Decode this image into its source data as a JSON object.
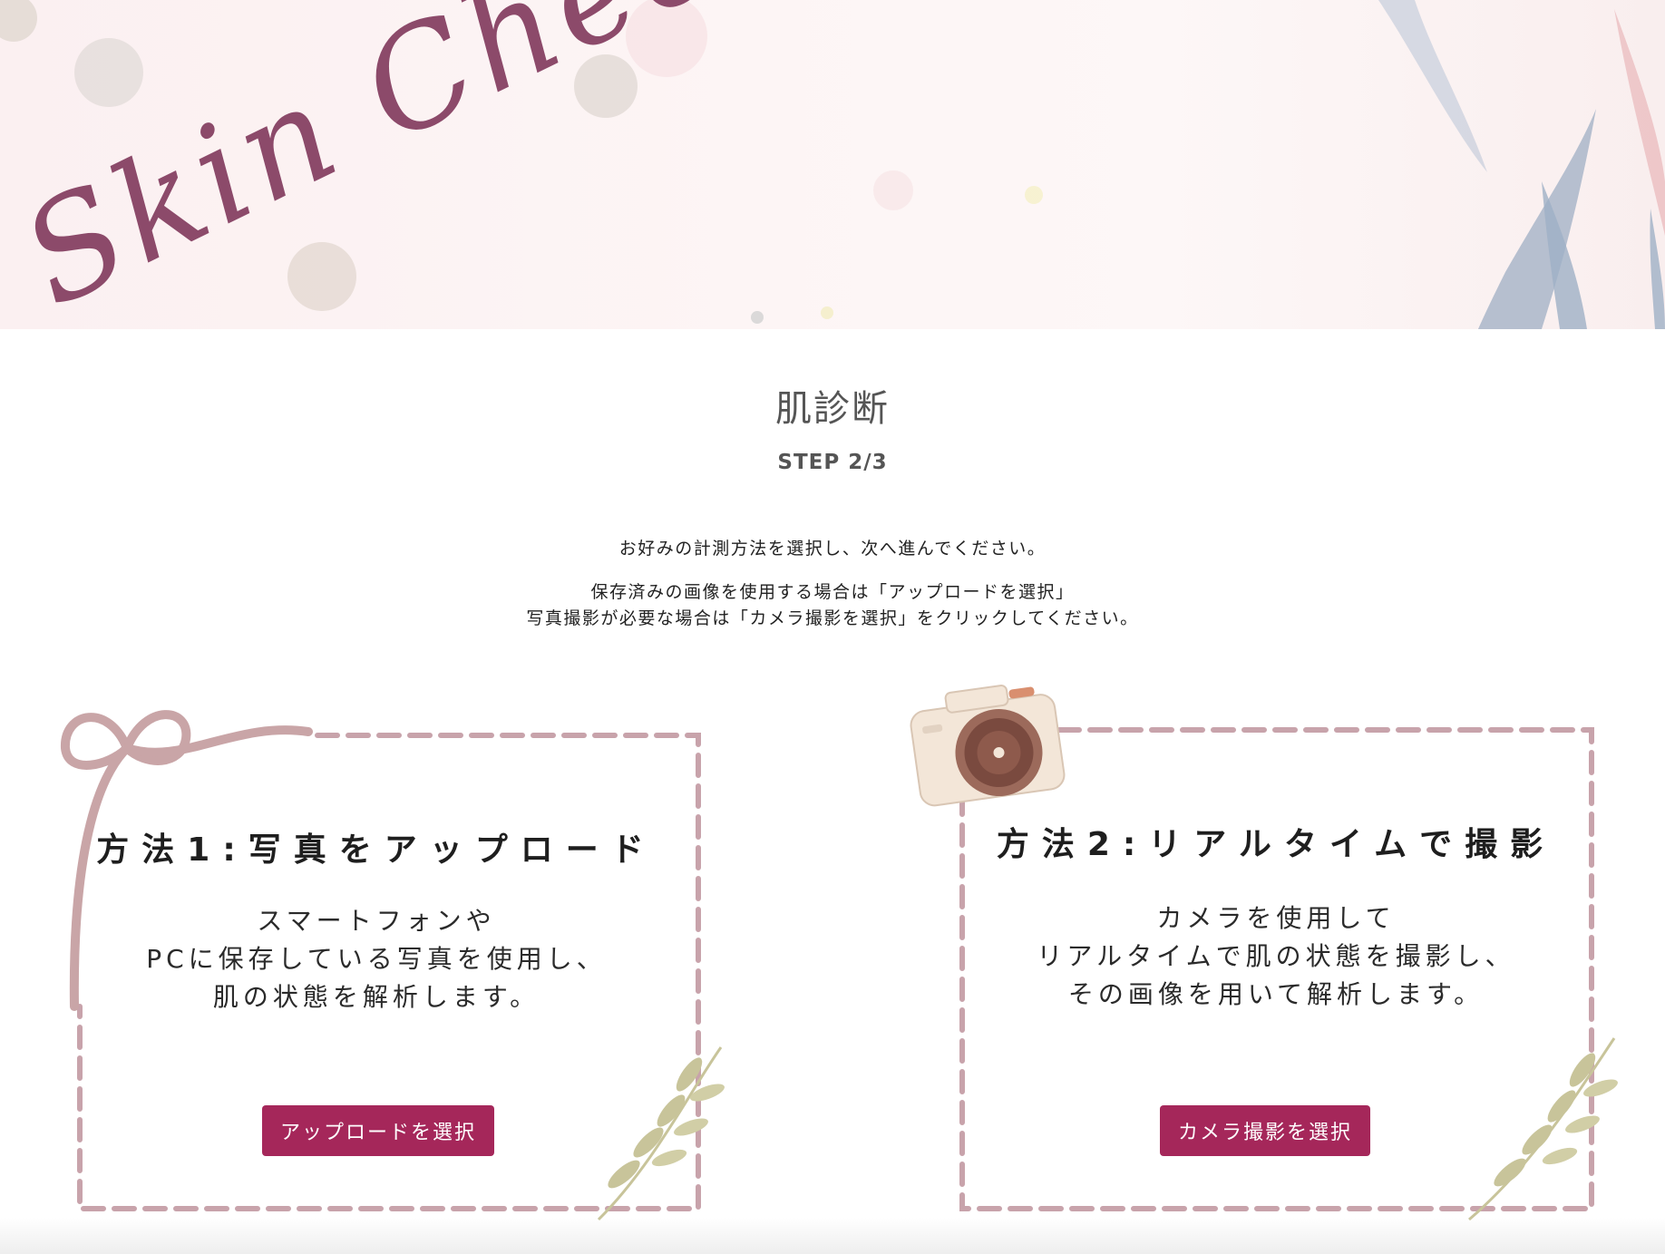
{
  "hero": {
    "script_title": "Skin Check"
  },
  "header": {
    "title": "肌診断",
    "step": "STEP 2/3"
  },
  "intro": {
    "line1": "お好みの計測方法を選択し、次へ進んでください。",
    "line2": "保存済みの画像を使用する場合は「アップロードを選択」",
    "line3": "写真撮影が必要な場合は「カメラ撮影を選択」をクリックしてください。"
  },
  "methods": [
    {
      "title": "方法1:写真をアップロード",
      "desc": [
        "スマートフォンや",
        "PCに保存している写真を使用し、",
        "肌の状態を解析します。"
      ],
      "button": "アップロードを選択",
      "decoration": "ribbon-icon"
    },
    {
      "title": "方法2:リアルタイムで撮影",
      "desc": [
        "カメラを使用して",
        "リアルタイムで肌の状態を撮影し、",
        "その画像を用いて解析します。"
      ],
      "button": "カメラ撮影を選択",
      "decoration": "camera-icon"
    }
  ],
  "colors": {
    "accent": "#a5275a",
    "dashed_border": "#c8a3ab",
    "script_title": "#8c4a6a",
    "leaf": "#c8c49a"
  }
}
